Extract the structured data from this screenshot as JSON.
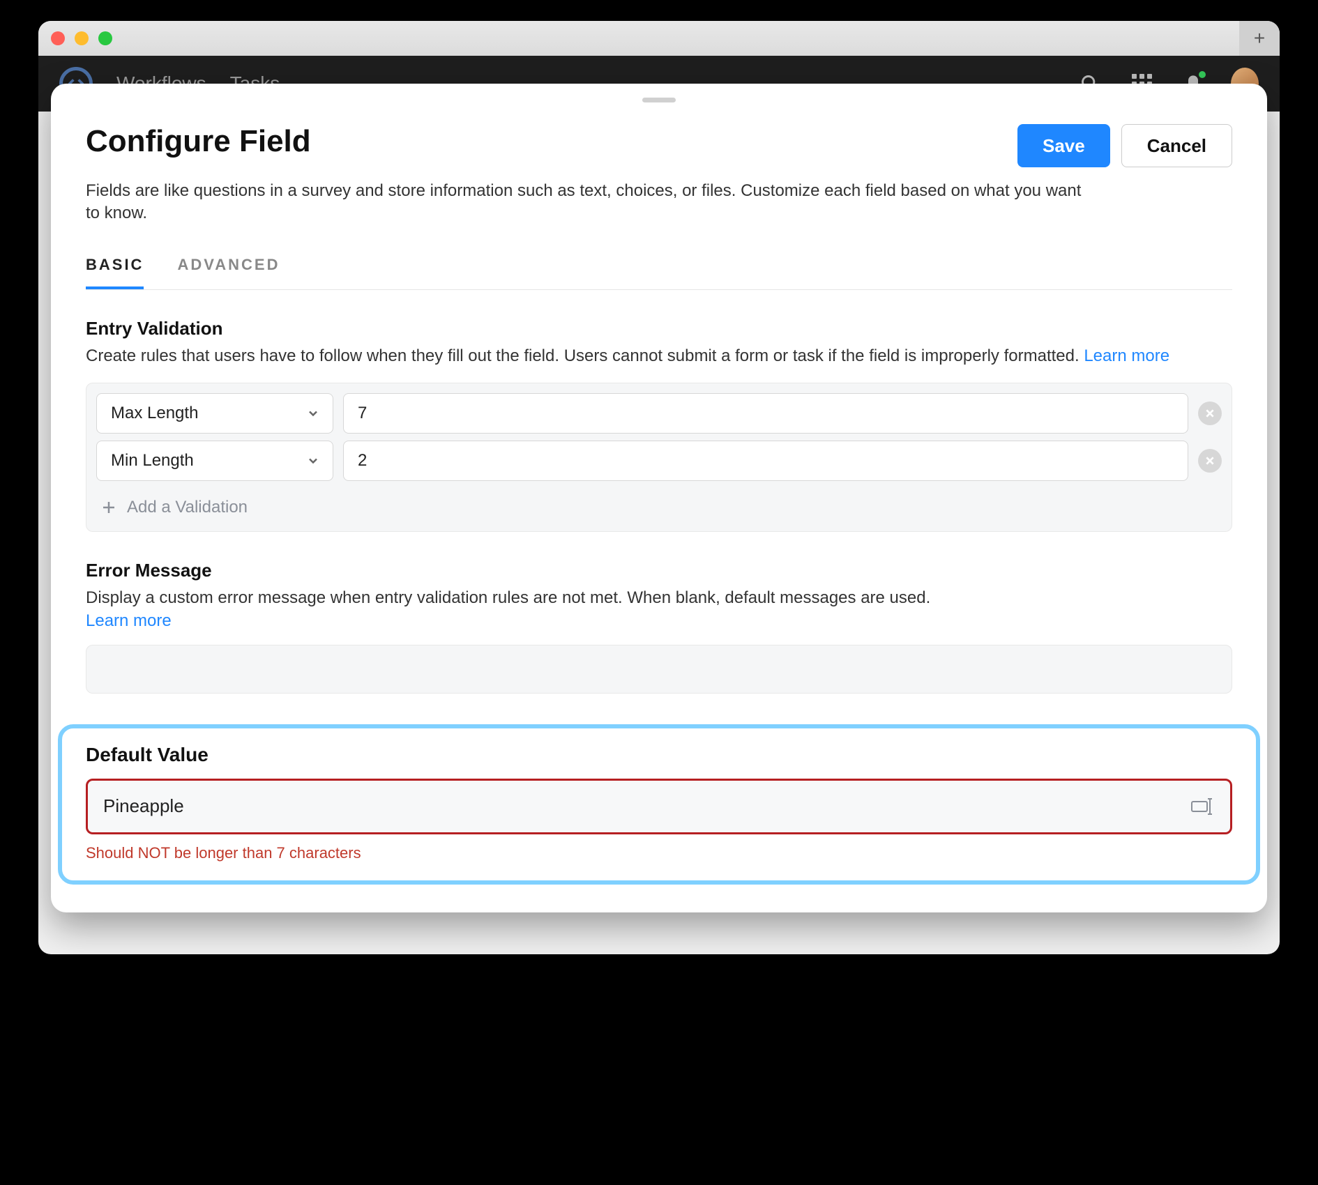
{
  "header": {
    "nav": [
      "Workflows",
      "Tasks"
    ]
  },
  "sheet": {
    "title": "Configure Field",
    "description": "Fields are like questions in a survey and store information such as text, choices, or files. Customize each field based on what you want to know.",
    "save_label": "Save",
    "cancel_label": "Cancel",
    "tabs": {
      "basic": "BASIC",
      "advanced": "ADVANCED"
    }
  },
  "entry_validation": {
    "title": "Entry Validation",
    "description": "Create rules that users have to follow when they fill out the field. Users cannot submit a form or task if the field is improperly formatted. ",
    "learn_more": "Learn more",
    "rules": [
      {
        "type": "Max Length",
        "value": "7"
      },
      {
        "type": "Min Length",
        "value": "2"
      }
    ],
    "add_label": "Add a Validation"
  },
  "error_message": {
    "title": "Error Message",
    "description": "Display a custom error message when entry validation rules are not met. When blank, default messages are used.",
    "learn_more": "Learn more"
  },
  "default_value": {
    "title": "Default Value",
    "value": "Pineapple",
    "error": "Should NOT be longer than 7 characters"
  }
}
